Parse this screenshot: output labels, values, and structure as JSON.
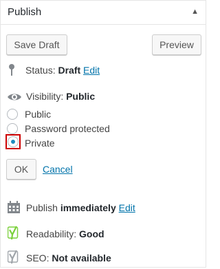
{
  "header": {
    "title": "Publish",
    "toggle_icon": "triangle-up"
  },
  "actions": {
    "save_draft": "Save Draft",
    "preview": "Preview"
  },
  "status": {
    "label": "Status:",
    "value": "Draft",
    "edit": "Edit"
  },
  "visibility": {
    "label": "Visibility:",
    "value": "Public",
    "options": [
      {
        "label": "Public",
        "checked": false
      },
      {
        "label": "Password protected",
        "checked": false
      },
      {
        "label": "Private",
        "checked": true
      }
    ],
    "ok": "OK",
    "cancel": "Cancel"
  },
  "publish": {
    "label": "Publish",
    "value": "immediately",
    "edit": "Edit"
  },
  "readability": {
    "label": "Readability:",
    "value": "Good"
  },
  "seo": {
    "label": "SEO:",
    "value": "Not available"
  },
  "colors": {
    "link": "#0073aa",
    "highlight": "#cc0000",
    "radio_dot": "#1e8cbe",
    "yoast_green": "#7ad03a"
  }
}
